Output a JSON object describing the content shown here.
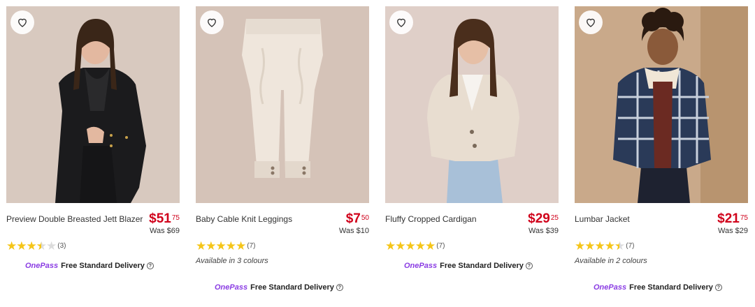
{
  "products": [
    {
      "name": "Preview Double Breasted Jett Blazer",
      "price_dollars": "$51",
      "price_cents": "75",
      "was": "Was $69",
      "rating": 3.5,
      "review_count": "(3)",
      "colours": "",
      "delivery_brand": "OnePass",
      "delivery_text": "Free Standard Delivery"
    },
    {
      "name": "Baby Cable Knit Leggings",
      "price_dollars": "$7",
      "price_cents": "50",
      "was": "Was $10",
      "rating": 5,
      "review_count": "(7)",
      "colours": "Available in 3 colours",
      "delivery_brand": "OnePass",
      "delivery_text": "Free Standard Delivery"
    },
    {
      "name": "Fluffy Cropped Cardigan",
      "price_dollars": "$29",
      "price_cents": "25",
      "was": "Was $39",
      "rating": 5,
      "review_count": "(7)",
      "colours": "",
      "delivery_brand": "OnePass",
      "delivery_text": "Free Standard Delivery"
    },
    {
      "name": "Lumbar Jacket",
      "price_dollars": "$21",
      "price_cents": "75",
      "was": "Was $29",
      "rating": 4.5,
      "review_count": "(7)",
      "colours": "Available in 2 colours",
      "delivery_brand": "OnePass",
      "delivery_text": "Free Standard Delivery"
    }
  ],
  "icons": {
    "wishlist": "heart-outline-icon",
    "star": "star-icon",
    "help": "question-circle-icon"
  },
  "colors": {
    "price": "#d0021b",
    "star": "#f5c518",
    "onepass": "#8a3ce3"
  }
}
